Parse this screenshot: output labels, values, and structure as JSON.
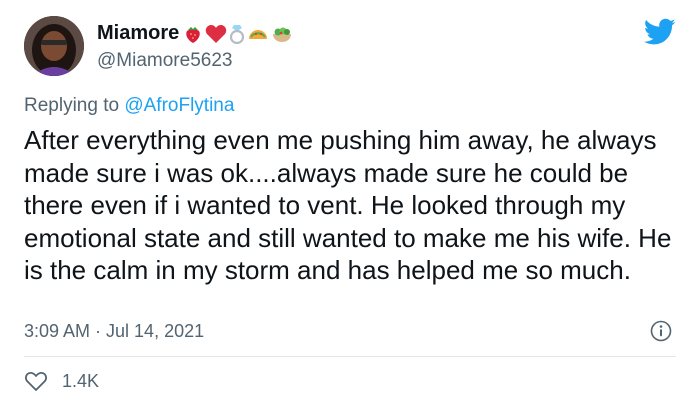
{
  "user": {
    "display_name": "Miamore",
    "handle": "@Miamore5623",
    "name_emojis": [
      "strawberry-icon",
      "red-heart-icon",
      "ring-icon",
      "taco-icon",
      "salad-icon"
    ]
  },
  "reply": {
    "prefix": "Replying to",
    "mention": "@AfroFlytina"
  },
  "tweet": {
    "text": "After everything even me pushing him away, he always made sure i was ok....always made sure he could be there even if i wanted to vent. He looked through my emotional state and still wanted to make me his wife. He is the calm in my storm and has helped me so much.",
    "timestamp": "3:09 AM · Jul 14, 2021",
    "likes": "1.4K"
  },
  "colors": {
    "twitter_blue": "#1da1f2",
    "secondary_text": "#536471",
    "primary_text": "#0f1419"
  },
  "icons": {
    "brand": "twitter-bird-icon",
    "info": "info-icon",
    "like": "heart-outline-icon"
  }
}
